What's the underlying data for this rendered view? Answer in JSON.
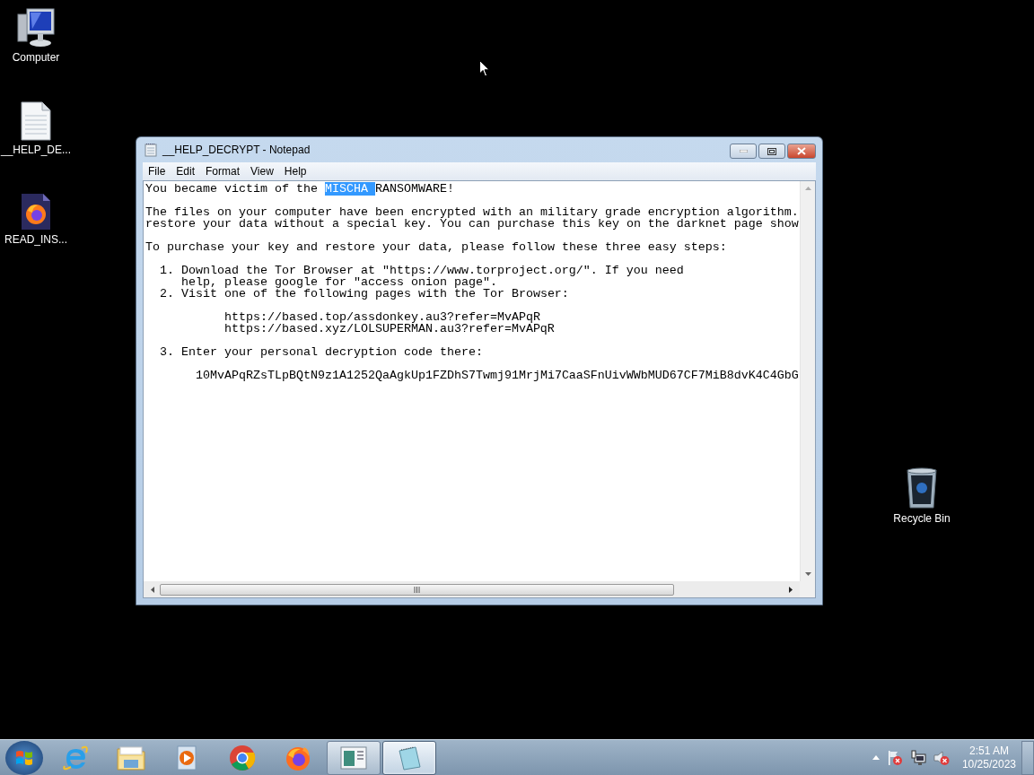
{
  "desktop_icons": [
    {
      "kind": "computer",
      "label": "Computer"
    },
    {
      "kind": "text-file",
      "label": "__HELP_DE..."
    },
    {
      "kind": "firefox-file",
      "label": "READ_INS..."
    },
    {
      "kind": "recycle-bin",
      "label": "Recycle Bin"
    }
  ],
  "window": {
    "title": "__HELP_DECRYPT - Notepad",
    "menu": [
      "File",
      "Edit",
      "Format",
      "View",
      "Help"
    ],
    "document": {
      "heading": {
        "before": "You became victim of the ",
        "selected": "MISCHA ",
        "after": "RANSOMWARE!"
      },
      "paragraphs": [
        [
          "The files on your computer have been encrypted with an military grade encryption algorithm.",
          "restore your data without a special key. You can purchase this key on the darknet page show"
        ],
        [
          "To purchase your key and restore your data, please follow these three easy steps:"
        ]
      ],
      "steps": [
        {
          "number": "1.",
          "lines": [
            "Download the Tor Browser at \"https://www.torproject.org/\". If you need",
            "help, please google for \"access onion page\"."
          ]
        },
        {
          "number": "2.",
          "lines": [
            "Visit one of the following pages with the Tor Browser:"
          ],
          "links": [
            "https://based.top/assdonkey.au3?refer=MvAPqR",
            "https://based.xyz/LOLSUPERMAN.au3?refer=MvAPqR"
          ]
        },
        {
          "number": "3.",
          "lines": [
            "Enter your personal decryption code there:"
          ],
          "code": "10MvAPqRZsTLpBQtN9z1A1252QaAgkUp1FZDhS7Twmj91MrjMi7CaaSFnUivWWbMUD67CF7MiB8dvK4C4GbG"
        }
      ]
    }
  },
  "taskbar": {
    "items": [
      {
        "kind": "ie",
        "running": false,
        "selected": false
      },
      {
        "kind": "explorer",
        "running": false,
        "selected": false
      },
      {
        "kind": "media",
        "running": false,
        "selected": false
      },
      {
        "kind": "chrome",
        "running": false,
        "selected": false
      },
      {
        "kind": "firefox",
        "running": false,
        "selected": false
      },
      {
        "kind": "app",
        "running": true,
        "selected": false
      },
      {
        "kind": "notepad",
        "running": true,
        "selected": true
      }
    ],
    "tray": {
      "time": "2:51 AM",
      "date": "10/25/2023"
    }
  }
}
